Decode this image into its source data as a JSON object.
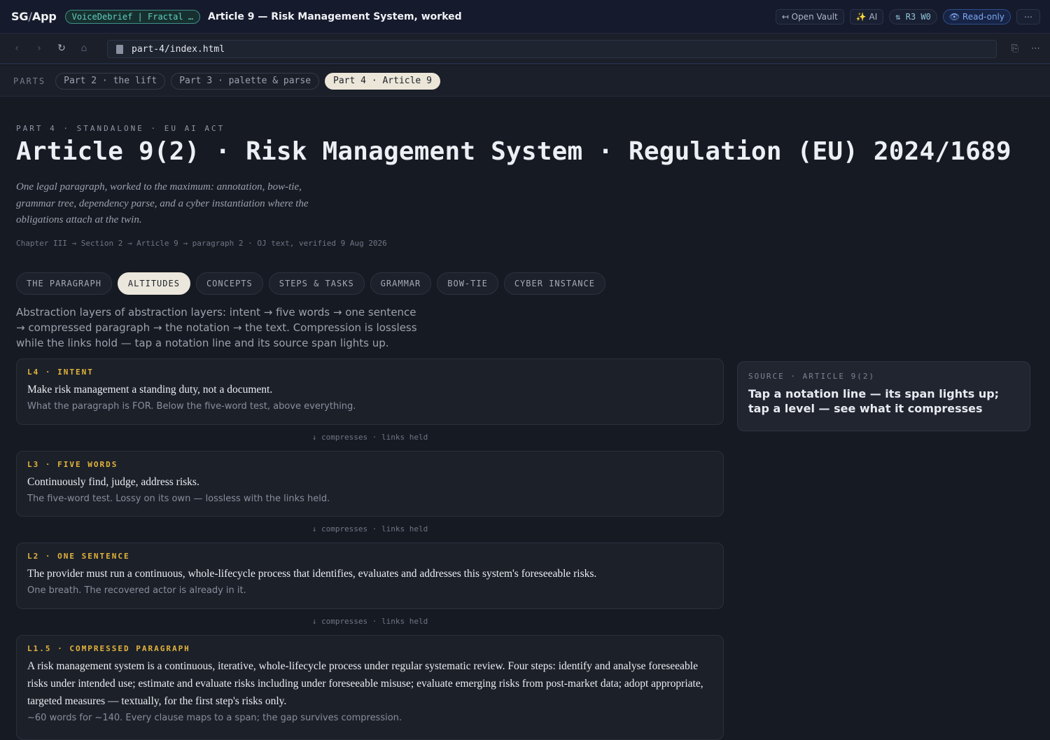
{
  "app": {
    "brand_main": "SG",
    "brand_slash": "/",
    "brand_app": "App",
    "vault_chip": "VoiceDebrief | Fractal …",
    "title": "Article 9 — Risk Management System, worked",
    "toolbar": {
      "open_vault": "↤ Open Vault",
      "ai": "✨ AI",
      "rw": "⇅ R3  W0",
      "read_only": "👁 Read-only",
      "more": "⋯"
    }
  },
  "address": {
    "back": "‹",
    "forward": "›",
    "reload": "↻",
    "home": "⌂",
    "url": "part-4/index.html",
    "copy": "⎘",
    "more": "⋯"
  },
  "parts": {
    "label": "PARTS",
    "tabs": [
      {
        "label": "Part 2 · the lift"
      },
      {
        "label": "Part 3 · palette & parse"
      },
      {
        "label": "Part 4 · Article 9"
      }
    ],
    "active_index": 2
  },
  "page": {
    "eyebrow": "PART 4 · STANDALONE · EU AI ACT",
    "title": "Article 9(2) · Risk Management System · Regulation (EU) 2024/1689",
    "subtitle": "One legal paragraph, worked to the maximum: annotation, bow-tie, grammar tree, dependency parse, and a cyber instantiation where the obligations attach at the twin.",
    "breadcrumb": "Chapter III → Section 2 → Article 9 → paragraph 2 · OJ text, verified 9 Aug 2026",
    "tabs": [
      {
        "label": "THE PARAGRAPH"
      },
      {
        "label": "ALTITUDES"
      },
      {
        "label": "CONCEPTS"
      },
      {
        "label": "STEPS & TASKS"
      },
      {
        "label": "GRAMMAR"
      },
      {
        "label": "BOW-TIE"
      },
      {
        "label": "CYBER INSTANCE"
      }
    ],
    "active_tab": 1,
    "intro": "Abstraction layers of abstraction layers: intent → five words → one sentence → compressed paragraph → the notation → the text. Compression is lossless while the links hold — tap a notation line and its source span lights up."
  },
  "levels": [
    {
      "level": "L4 · INTENT",
      "text": "Make risk management a standing duty, not a document.",
      "note": "What the paragraph is FOR. Below the five-word test, above everything."
    },
    {
      "level": "L3 · FIVE WORDS",
      "text": "Continuously find, judge, address risks.",
      "note": "The five-word test. Lossy on its own — lossless with the links held."
    },
    {
      "level": "L2 · ONE SENTENCE",
      "text": "The provider must run a continuous, whole-lifecycle process that identifies, evaluates and addresses this system's foreseeable risks.",
      "note": "One breath. The recovered actor is already in it."
    },
    {
      "level": "L1.5 · COMPRESSED PARAGRAPH",
      "text": "A risk management system is a continuous, iterative, whole-lifecycle process under regular systematic review. Four steps: identify and analyse foreseeable risks under intended use; estimate and evaluate risks including under foreseeable misuse; evaluate emerging risks from post-market data; adopt appropriate, targeted measures — textually, for the first step's risks only.",
      "note": "~60 words for ~140. Every clause maps to a span; the gap survives compression."
    }
  ],
  "connector": "↓ compresses · links held",
  "source_panel": {
    "label": "SOURCE · ARTICLE 9(2)",
    "text": "Tap a notation line — its span lights up; tap a level — see what it compresses"
  }
}
